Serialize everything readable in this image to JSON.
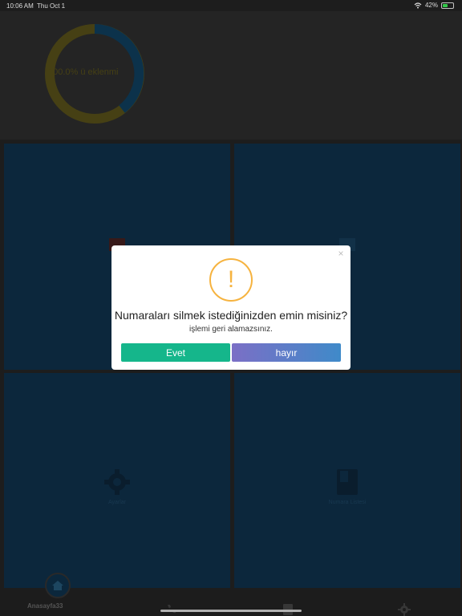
{
  "status_bar": {
    "time": "10:06 AM",
    "date": "Thu Oct 1",
    "battery": "42%"
  },
  "header": {
    "progress_label": "100.0% ü eklenmi",
    "progress_value": 1.0
  },
  "tiles": [
    {
      "name": "tile-top-left",
      "label": ""
    },
    {
      "name": "tile-top-right",
      "label": ""
    },
    {
      "name": "tile-settings",
      "label": "Ayarlar"
    },
    {
      "name": "tile-book",
      "label": "Numara Listesi"
    }
  ],
  "tabbar": {
    "home_label": "Anasayfa33"
  },
  "dialog": {
    "icon": "!",
    "title": "Numaraları silmek istediğinizden emin misiniz?",
    "message": "işlemi geri alamazsınız.",
    "yes_label": "Evet",
    "no_label": "hayır",
    "close_label": "×"
  },
  "colors": {
    "accent_green": "#15b68b",
    "accent_purple": "#7b6fc6",
    "accent_blue": "#3f8ac9",
    "warning": "#f6b33f",
    "donut_yellow": "#4a4416",
    "donut_blue": "#0d3550"
  }
}
